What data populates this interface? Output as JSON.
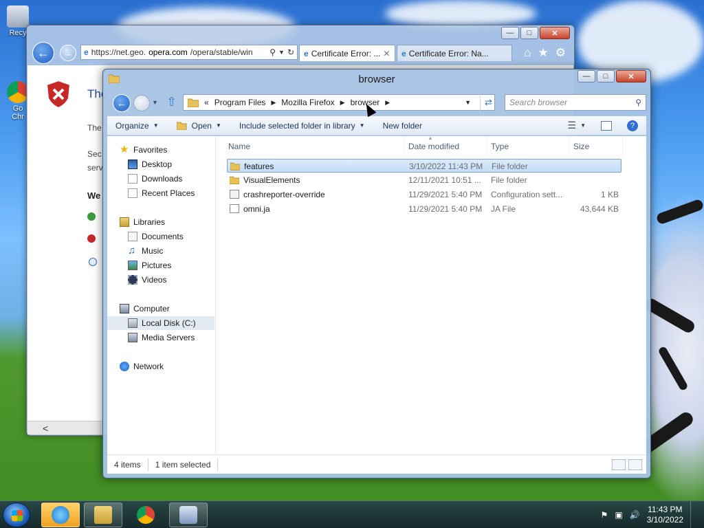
{
  "desktop": {
    "icons": [
      {
        "label": "Recy"
      },
      {
        "label": "Go\nChr"
      }
    ]
  },
  "ie": {
    "address": "https://net.geo.opera.com/opera/stable/win",
    "address_prefix": "https://net.geo.",
    "address_domain": "opera.com",
    "address_suffix": "/opera/stable/win",
    "tabs": [
      {
        "label": "Certificate Error: ..."
      },
      {
        "label": "Certificate Error: Na..."
      }
    ],
    "page_title_fragment": "The",
    "line1": "The",
    "line2a": "Sec",
    "line2b": "serv",
    "line3": "We",
    "scroll_arrow": "<"
  },
  "explorer": {
    "title": "browser",
    "breadcrumb": [
      "Program Files",
      "Mozilla Firefox",
      "browser"
    ],
    "breadcrumb_overflow": "«",
    "search_placeholder": "Search browser",
    "toolbar": {
      "organize": "Organize",
      "open": "Open",
      "include": "Include selected folder in library",
      "new_folder": "New folder"
    },
    "nav": {
      "favorites": "Favorites",
      "desktop": "Desktop",
      "downloads": "Downloads",
      "recent": "Recent Places",
      "libraries": "Libraries",
      "documents": "Documents",
      "music": "Music",
      "pictures": "Pictures",
      "videos": "Videos",
      "computer": "Computer",
      "local_disk": "Local Disk (C:)",
      "media_servers": "Media Servers",
      "network": "Network"
    },
    "columns": {
      "name": "Name",
      "date": "Date modified",
      "type": "Type",
      "size": "Size"
    },
    "files": [
      {
        "name": "features",
        "date": "3/10/2022 11:43 PM",
        "type": "File folder",
        "size": ""
      },
      {
        "name": "VisualElements",
        "date": "12/11/2021 10:51 ...",
        "type": "File folder",
        "size": ""
      },
      {
        "name": "crashreporter-override",
        "date": "11/29/2021 5:40 PM",
        "type": "Configuration sett...",
        "size": "1 KB"
      },
      {
        "name": "omni.ja",
        "date": "11/29/2021 5:40 PM",
        "type": "JA File",
        "size": "43,644 KB"
      }
    ],
    "status": {
      "count": "4 items",
      "selected": "1 item selected"
    }
  },
  "taskbar": {
    "time": "11:43 PM",
    "date": "3/10/2022"
  },
  "colors": {
    "accent": "#1e5fc2",
    "selection": "#c4ddf8",
    "folder": "#e8c15a"
  }
}
